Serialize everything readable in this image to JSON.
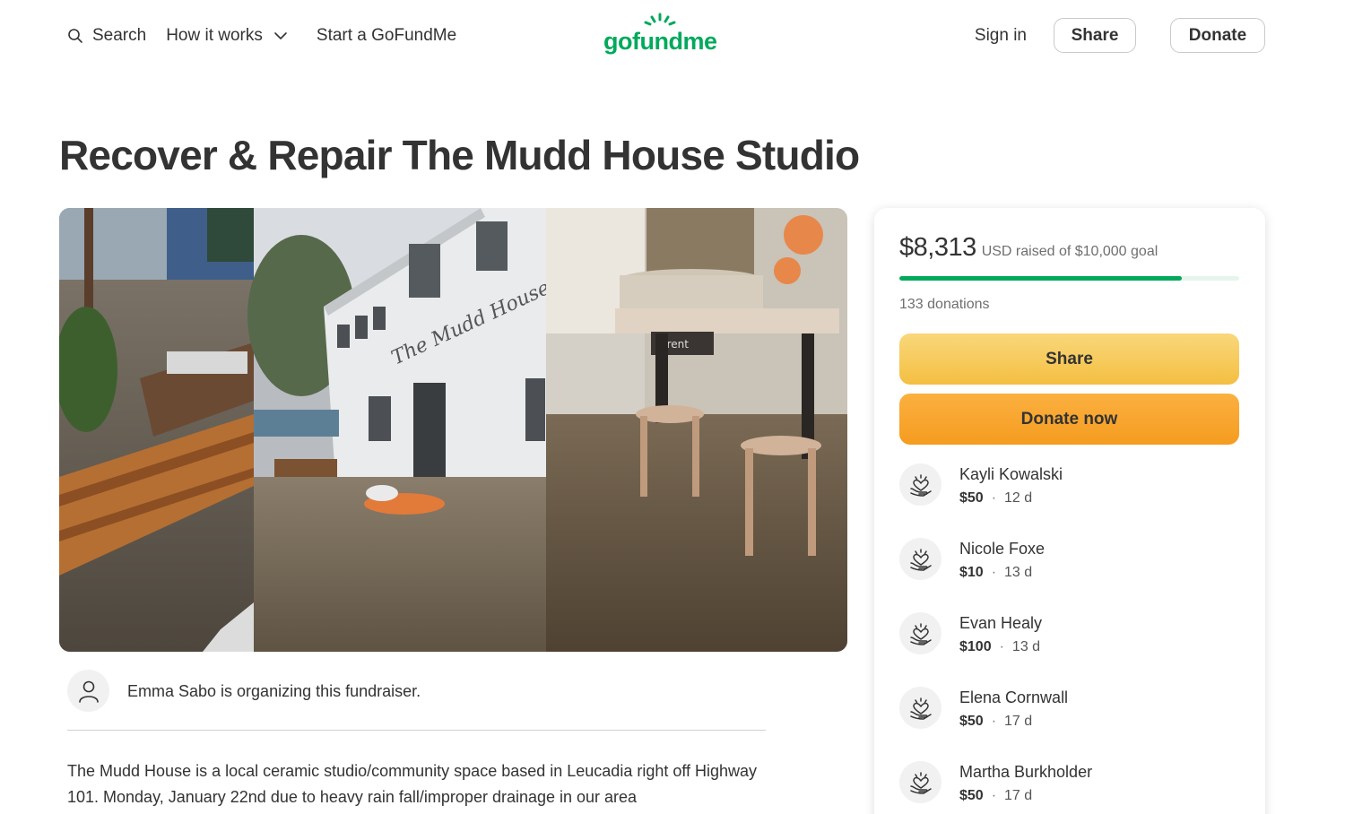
{
  "header": {
    "search_label": "Search",
    "how_it_works_label": "How it works",
    "start_label": "Start a GoFundMe",
    "logo_text": "gofundme",
    "signin_label": "Sign in",
    "share_label": "Share",
    "donate_label": "Donate"
  },
  "campaign": {
    "title": "Recover & Repair The Mudd House Studio",
    "organizer_text": "Emma Sabo is organizing this fundraiser.",
    "story": "The Mudd House is a local ceramic studio/community space based in Leucadia right off Highway 101. Monday, January 22nd due to heavy rain fall/improper drainage in our area"
  },
  "photo_text": {
    "sign": "The Mudd House",
    "wheel_brand": "brent"
  },
  "card": {
    "raised_amount": "$8,313",
    "goal_text": "USD raised of $10,000 goal",
    "progress_fraction": 0.8313,
    "donations_count": "133 donations",
    "share_button": "Share",
    "donate_button": "Donate now",
    "donors": [
      {
        "name": "Kayli Kowalski",
        "amount": "$50",
        "time": "12 d"
      },
      {
        "name": "Nicole Foxe",
        "amount": "$10",
        "time": "13 d"
      },
      {
        "name": "Evan Healy",
        "amount": "$100",
        "time": "13 d"
      },
      {
        "name": "Elena Cornwall",
        "amount": "$50",
        "time": "17 d"
      },
      {
        "name": "Martha Burkholder",
        "amount": "$50",
        "time": "17 d"
      }
    ]
  },
  "colors": {
    "brand_green": "#02a95c",
    "share_yellow": "#f4bf42",
    "donate_orange": "#f59c20"
  },
  "icons": {
    "search": "search-icon",
    "chevron": "chevron-down-icon",
    "organizer": "user-icon",
    "donor": "heart-hand-icon"
  }
}
